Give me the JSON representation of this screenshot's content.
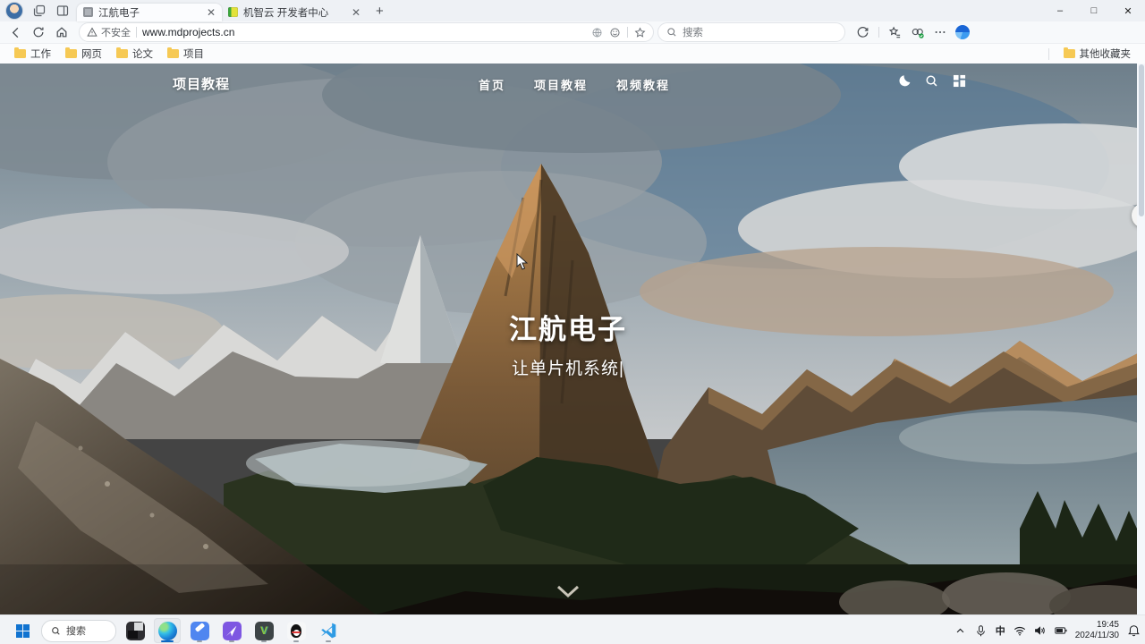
{
  "browser": {
    "tabs": [
      {
        "title": "江航电子"
      },
      {
        "title": "机智云 开发者中心"
      }
    ],
    "new_tab_glyph": "+",
    "address": {
      "security_label": "不安全",
      "url": "www.mdprojects.cn"
    },
    "search_placeholder": "搜索",
    "bookmarks": [
      "工作",
      "网页",
      "论文",
      "项目"
    ],
    "other_bookmarks": "其他收藏夹",
    "window_controls": {
      "minimize": "–",
      "maximize": "□",
      "close": "✕"
    },
    "tab_close_glyph": "✕"
  },
  "site": {
    "logo": "项目教程",
    "nav": [
      "首页",
      "项目教程",
      "视频教程"
    ],
    "hero_title": "江航电子",
    "hero_subtitle": "让单片机系统",
    "caret": "|"
  },
  "taskbar": {
    "search_label": "搜索",
    "ime": "中",
    "time": "19:45",
    "date": "2024/11/30"
  },
  "colors": {
    "accent_blue": "#0b66c3",
    "edge_brand": "#1b82d8",
    "folder_yellow": "#f6c954",
    "taskbar_bg": "#f1f3f6",
    "chrome_bg": "#eef1f5"
  }
}
